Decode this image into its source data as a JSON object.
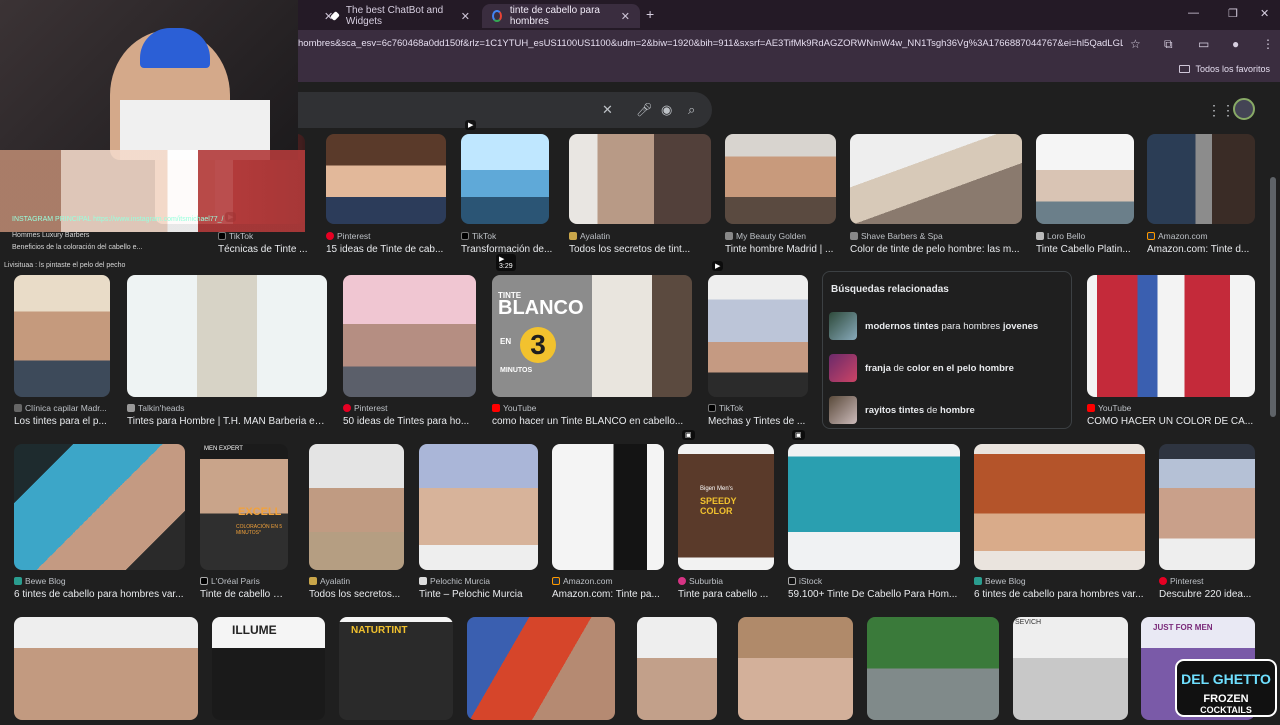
{
  "tabs": [
    {
      "label": "The best ChatBot and Widgets",
      "active": false
    },
    {
      "label": "tinte de cabello para hombres",
      "active": true
    }
  ],
  "address_bar": {
    "url": "hombres&sca_esv=6c760468a0dd150f&rlz=1C1YTUH_esUS1100US1100&udm=2&biw=1920&bih=911&sxsrf=AE3TifMk9RdAGZORWNmW4w_NN1Tsgh36Vg%3A1766887044767&ei=hl5QadLGLoq..."
  },
  "bookmarks": {
    "all_favorites": "Todos los favoritos"
  },
  "stream_overlay": {
    "chat_lines": [
      "Beneficios de la coloración del cabello e...",
      "Hommes Luxury Barbers",
      "INSTAGRAM PRINCIPAL https://www.instagram.com/itsmichael77_/",
      "Livisituaa : ls pintaste el pelo del pecho"
    ],
    "brand_logo": "DEL GHETTO FROZEN COCKTAILS"
  },
  "row1": [
    {
      "source": "",
      "title": ""
    },
    {
      "source": "TikTok",
      "title": "Técnicas de Tinte ..."
    },
    {
      "source": "Pinterest",
      "title": "15 ideas de Tinte de cab..."
    },
    {
      "source": "TikTok",
      "title": "Transformación de..."
    },
    {
      "source": "Ayalatin",
      "title": "Todos los secretos de tint..."
    },
    {
      "source": "My Beauty Golden",
      "title": "Tinte hombre Madrid | ..."
    },
    {
      "source": "Shave Barbers & Spa",
      "title": "Color de tinte de pelo hombre: las m..."
    },
    {
      "source": "Loro Bello",
      "title": "Tinte Cabello Platin..."
    },
    {
      "source": "Amazon.com",
      "title": "Amazon.com: Tinte d..."
    }
  ],
  "row2": [
    {
      "source": "Clínica capilar Madr...",
      "title": "Los tintes para el p..."
    },
    {
      "source": "Talkin'heads",
      "title": "Tintes para Hombre | T.H. MAN Barberia en ..."
    },
    {
      "source": "Pinterest",
      "title": "50 ideas de Tintes para ho..."
    },
    {
      "source": "YouTube",
      "title": "como hacer un Tinte BLANCO en cabello..."
    },
    {
      "source": "TikTok",
      "title": "Mechas y Tintes de ..."
    },
    {
      "source": "YouTube",
      "title": "COMO HACER UN COLOR DE CA..."
    }
  ],
  "video_badge": {
    "text_main": "BLANCO",
    "text_top": "TINTE",
    "text_en": "EN",
    "number": "3",
    "minutos": "MINUTOS",
    "duration": "3:29"
  },
  "related": {
    "heading": "Búsquedas relacionadas",
    "items": [
      {
        "pre": "modernos tintes",
        "mid": " para hombres ",
        "post": "jovenes"
      },
      {
        "pre": "franja",
        "mid": " de ",
        "post": "color en el pelo hombre"
      },
      {
        "pre": "rayitos tintes",
        "mid": " de ",
        "post": "hombre"
      }
    ]
  },
  "row3": [
    {
      "source": "Bewe Blog",
      "title": "6 tintes de cabello para hombres var..."
    },
    {
      "source": "L'Oréal Paris",
      "title": "Tinte de cabello pa..."
    },
    {
      "source": "Ayalatin",
      "title": "Todos los secretos..."
    },
    {
      "source": "Pelochic Murcia",
      "title": "Tinte – Pelochic Murcia"
    },
    {
      "source": "Amazon.com",
      "title": "Amazon.com: Tinte pa..."
    },
    {
      "source": "Suburbia",
      "title": "Tinte para cabello ..."
    },
    {
      "source": "iStock",
      "title": "59.100+ Tinte De Cabello Para Hom..."
    },
    {
      "source": "Bewe Blog",
      "title": "6 tintes de cabello para hombres var..."
    },
    {
      "source": "Pinterest",
      "title": "Descubre 220 idea..."
    }
  ],
  "product_labels": {
    "excell": "EXCELL",
    "excell_sub": "COLORACIÓN EN 5 MINUTOS*",
    "men_expert": "MEN EXPERT",
    "speedy": "SPEEDY COLOR",
    "bigen": "Bigen Men's",
    "naturtint": "NATURTINT",
    "illume": "ILLUME",
    "sevich": "SEVICH",
    "just_for_men": "JUST FOR MEN"
  }
}
